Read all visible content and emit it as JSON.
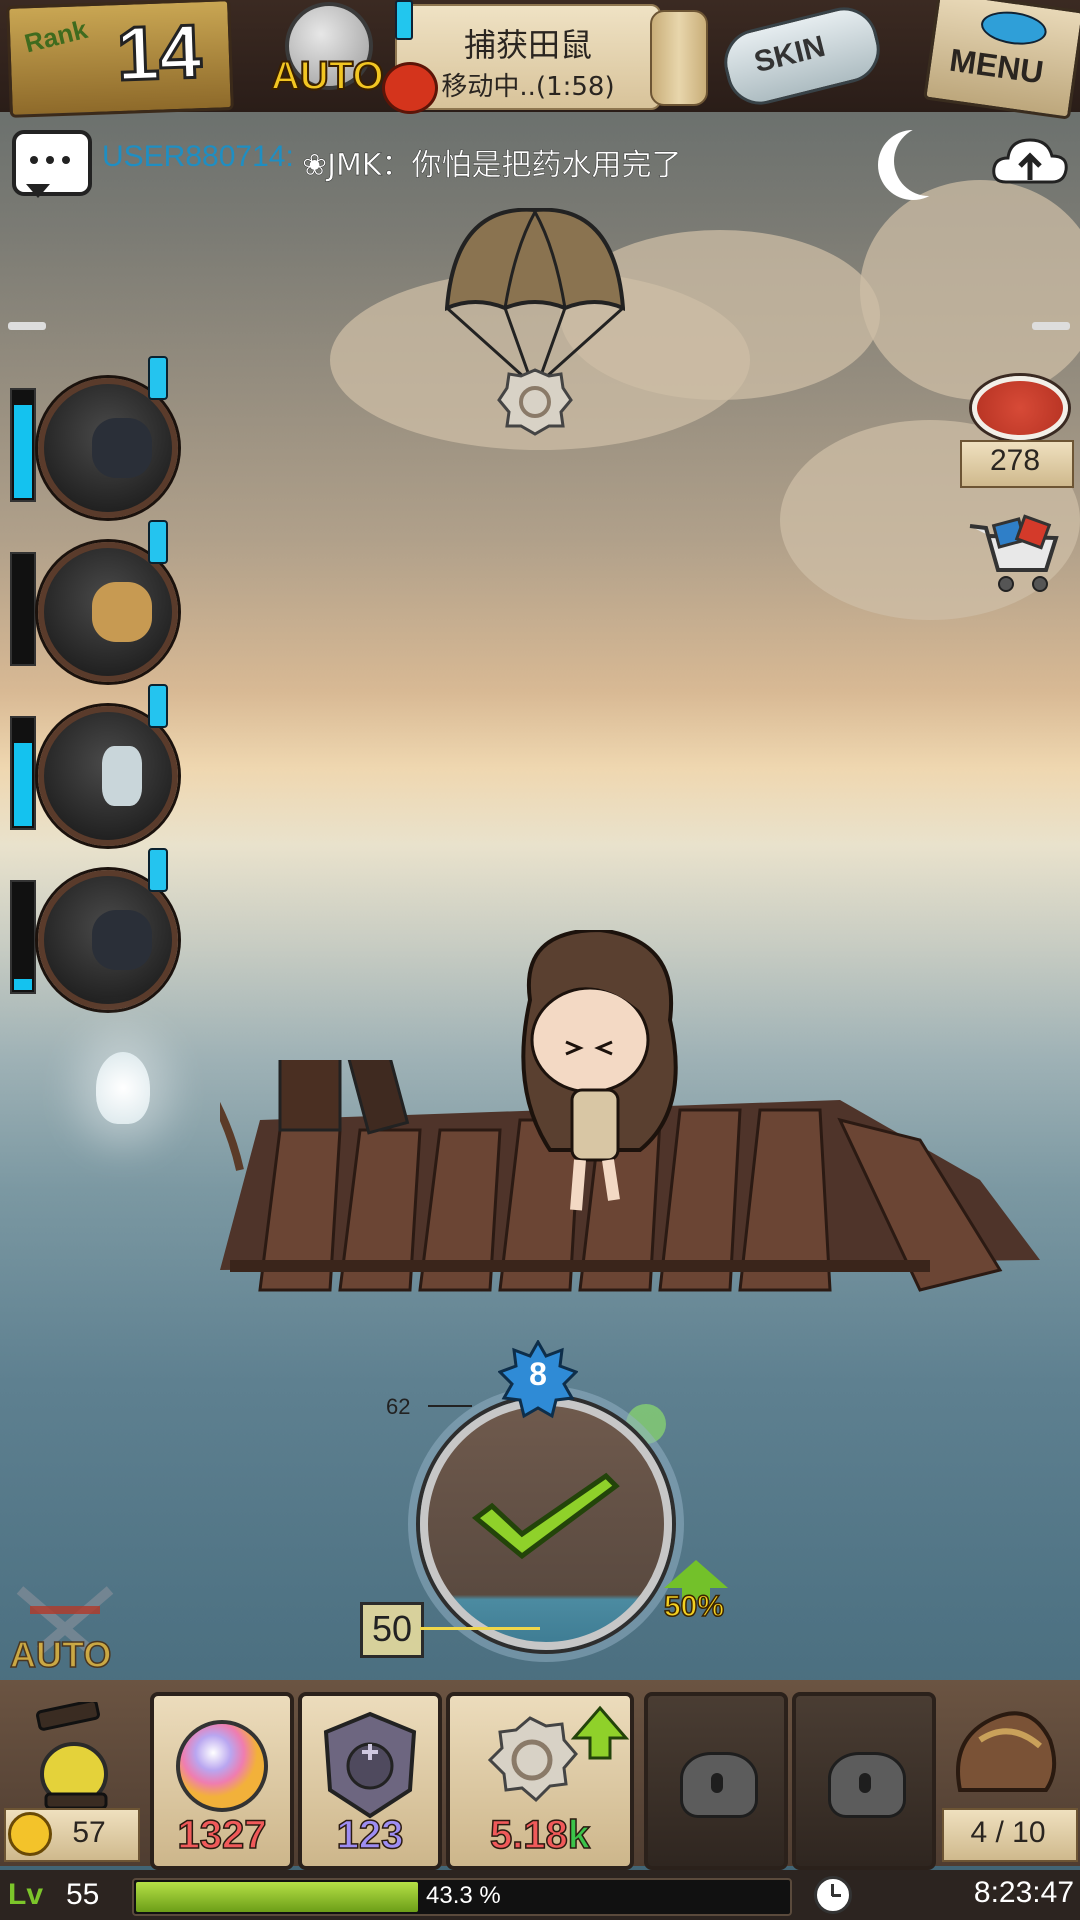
{
  "rank": {
    "label": "Rank",
    "value": "14"
  },
  "auto_badge": {
    "label": "AUTO"
  },
  "quest": {
    "title": "捕获田鼠",
    "status": "移动中..(1:58)"
  },
  "skin_button": {
    "label": "SKIN"
  },
  "menu_button": {
    "label": "MENU"
  },
  "chat": {
    "user": "USER880714:",
    "message": "❀JMK：你怕是把药水用完了"
  },
  "resources": {
    "meat": "278"
  },
  "party": [
    {
      "name_icon": "black-cat-portrait-icon",
      "hp_fraction": 0.88
    },
    {
      "name_icon": "antelope-girl-portrait-icon",
      "hp_fraction": 0.0
    },
    {
      "name_icon": "bottle-message-portrait-icon",
      "hp_fraction": 0.78
    },
    {
      "name_icon": "black-cat-portrait-icon",
      "hp_fraction": 0.1
    }
  ],
  "dial": {
    "level": "8",
    "upper_mark": "62",
    "lower_mark": "50",
    "bonus": "50%"
  },
  "auto_battle": {
    "label": "AUTO"
  },
  "items": [
    {
      "icon": "rainbow-orb-icon",
      "count": "1327",
      "color": "#f05a5a"
    },
    {
      "icon": "skull-shield-icon",
      "count": "123",
      "color": "#9e8ef3"
    },
    {
      "icon": "spiral-shell-icon",
      "count": "5.18k",
      "color": "#f05a5a",
      "suffix_color": "#3bc34a"
    },
    {
      "icon": "lock-icon",
      "locked": true
    },
    {
      "icon": "lock-icon",
      "locked": true
    }
  ],
  "coins": "57",
  "bag": "4 / 10",
  "status": {
    "level_label": "Lv",
    "level": "55",
    "xp_percent": "43.3 %",
    "xp_fraction": 0.433,
    "time": "8:23:47"
  }
}
